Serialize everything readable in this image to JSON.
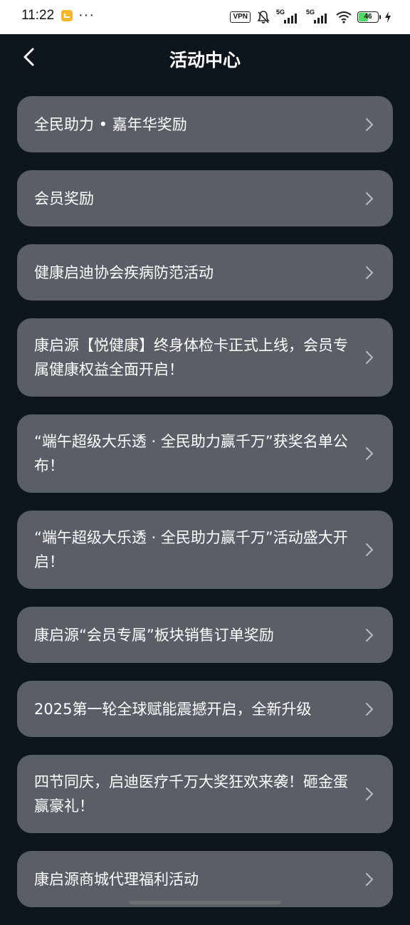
{
  "status_bar": {
    "time": "11:22",
    "vpn": "VPN",
    "signal1": "5G",
    "signal2": "5G",
    "battery": "46"
  },
  "header": {
    "title": "活动中心"
  },
  "items": [
    {
      "label": "全民助力 • 嘉年华奖励"
    },
    {
      "label": "会员奖励"
    },
    {
      "label": "健康启迪协会疾病防范活动"
    },
    {
      "label": "康启源【悦健康】终身体检卡正式上线，会员专属健康权益全面开启！"
    },
    {
      "label": "“端午超级大乐透 · 全民助力赢千万”获奖名单公布！"
    },
    {
      "label": "“端午超级大乐透 · 全民助力赢千万”活动盛大开启！"
    },
    {
      "label": "康启源“会员专属”板块销售订单奖励"
    },
    {
      "label": "2025第一轮全球赋能震撼开启，全新升级"
    },
    {
      "label": "四节同庆，启迪医疗千万大奖狂欢来袭！砸金蛋赢豪礼！"
    },
    {
      "label": "康启源商城代理福利活动"
    }
  ]
}
